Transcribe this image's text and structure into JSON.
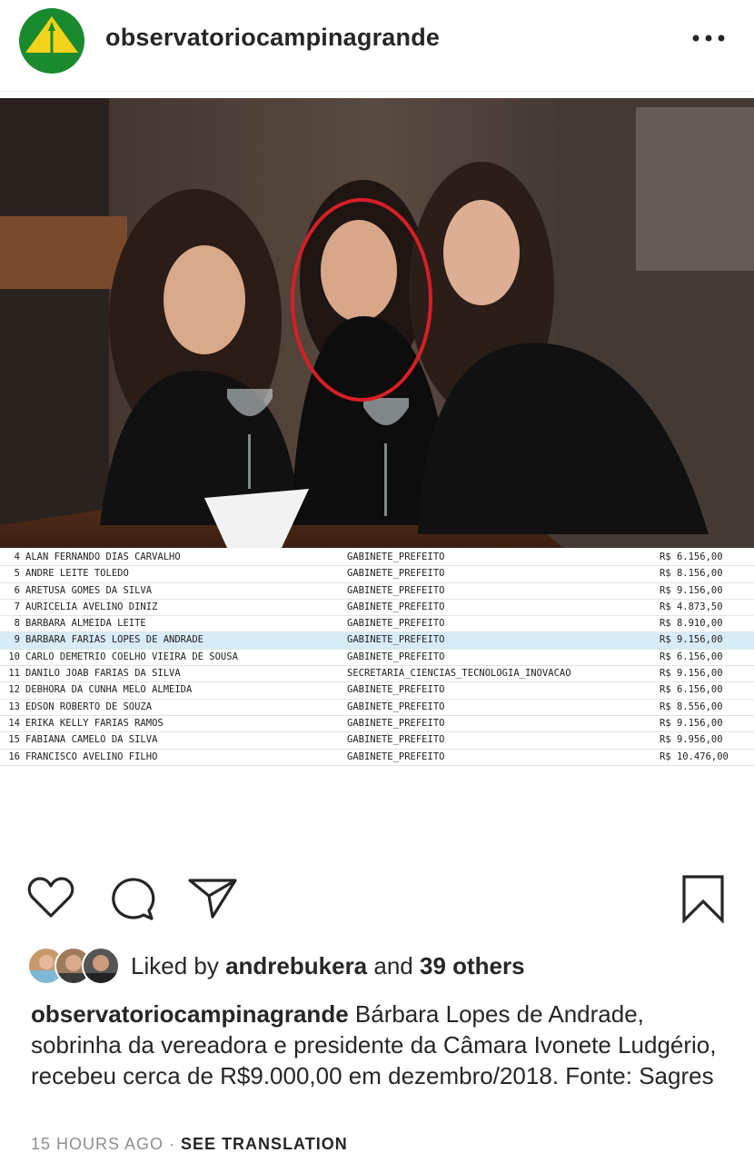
{
  "post": {
    "username": "observatoriocampinagrande",
    "more_icon": "more-horizontal-icon",
    "photo_alt": "Three women seated at a restaurant table"
  },
  "salary_table": {
    "rows": [
      {
        "num": "4",
        "name": "ALAN FERNANDO DIAS CARVALHO",
        "dept": "GABINETE_PREFEITO",
        "value": "R$ 6.156,00"
      },
      {
        "num": "5",
        "name": "ANDRE LEITE TOLEDO",
        "dept": "GABINETE_PREFEITO",
        "value": "R$ 8.156,00"
      },
      {
        "num": "6",
        "name": "ARETUSA GOMES DA SILVA",
        "dept": "GABINETE_PREFEITO",
        "value": "R$ 9.156,00"
      },
      {
        "num": "7",
        "name": "AURICELIA AVELINO DINIZ",
        "dept": "GABINETE_PREFEITO",
        "value": "R$ 4.873,50"
      },
      {
        "num": "8",
        "name": "BARBARA ALMEIDA LEITE",
        "dept": "GABINETE_PREFEITO",
        "value": "R$ 8.910,00"
      },
      {
        "num": "9",
        "name": "BARBARA FARIAS LOPES DE ANDRADE",
        "dept": "GABINETE_PREFEITO",
        "value": "R$ 9.156,00",
        "highlight": true
      },
      {
        "num": "10",
        "name": "CARLO DEMETRIO COELHO VIEIRA DE SOUSA",
        "dept": "GABINETE_PREFEITO",
        "value": "R$ 6.156,00"
      },
      {
        "num": "11",
        "name": "DANILO JOAB FARIAS DA SILVA",
        "dept": "SECRETARIA_CIENCIAS_TECNOLOGIA_INOVACAO",
        "value": "R$ 9.156,00"
      },
      {
        "num": "12",
        "name": "DEBHORA DA CUNHA MELO ALMEIDA",
        "dept": "GABINETE_PREFEITO",
        "value": "R$ 6.156,00"
      },
      {
        "num": "13",
        "name": "EDSON ROBERTO DE SOUZA",
        "dept": "GABINETE_PREFEITO",
        "value": "R$ 8.556,00"
      },
      {
        "num": "14",
        "name": "ERIKA KELLY FARIAS RAMOS",
        "dept": "GABINETE_PREFEITO",
        "value": "R$ 9.156,00"
      },
      {
        "num": "15",
        "name": "FABIANA CAMELO DA SILVA",
        "dept": "GABINETE_PREFEITO",
        "value": "R$ 9.956,00"
      },
      {
        "num": "16",
        "name": "FRANCISCO AVELINO FILHO",
        "dept": "GABINETE_PREFEITO",
        "value": "R$ 10.476,00"
      }
    ]
  },
  "actions": {
    "like_icon": "heart-icon",
    "comment_icon": "comment-icon",
    "share_icon": "send-icon",
    "save_icon": "bookmark-icon"
  },
  "likes": {
    "prefix": "Liked by ",
    "user": "andrebukera",
    "middle": " and ",
    "others": "39 others"
  },
  "caption": {
    "username": "observatoriocampinagrande",
    "text": "Bárbara Lopes de Andrade, sobrinha da vereadora e presidente da Câmara Ivonete Ludgério, recebeu cerca de R$9.000,00 em dezembro/2018. Fonte: Sagres"
  },
  "meta": {
    "time": "15 HOURS AGO",
    "separator": " · ",
    "see_translation": "SEE TRANSLATION"
  },
  "colors": {
    "avatar_green": "#1a8a2e",
    "avatar_yellow": "#f2d21b",
    "highlight_row": "#d7ecf7",
    "circle_red": "#d61f26"
  }
}
